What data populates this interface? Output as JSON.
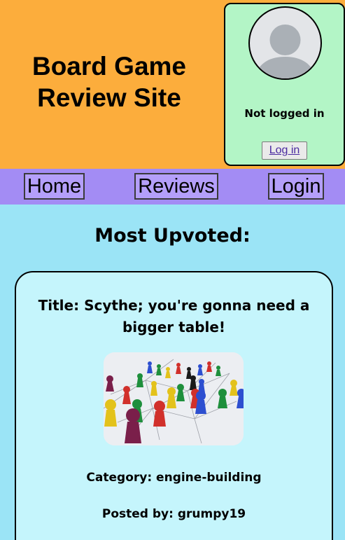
{
  "header": {
    "site_title_line1": "Board Game",
    "site_title_line2": "Review Site",
    "background_color": "#fcad3c"
  },
  "user_box": {
    "avatar_icon": "default-user-avatar-icon",
    "status_text": "Not logged in",
    "login_link_label": "Log in",
    "background_color": "#b3f5c6"
  },
  "nav": {
    "background_color": "#a38cf4",
    "items": [
      {
        "label": "Home"
      },
      {
        "label": "Reviews"
      },
      {
        "label": "Login"
      }
    ]
  },
  "main": {
    "section_heading": "Most Upvoted:",
    "background_color": "#9be4f6",
    "review": {
      "title": "Title: Scythe; you're gonna need a bigger table!",
      "image_subject": "colored-board-game-pawns-on-network",
      "category": "Category: engine-building",
      "posted_by": "Posted by: grumpy19",
      "card_color": "#c5f5fc"
    }
  }
}
